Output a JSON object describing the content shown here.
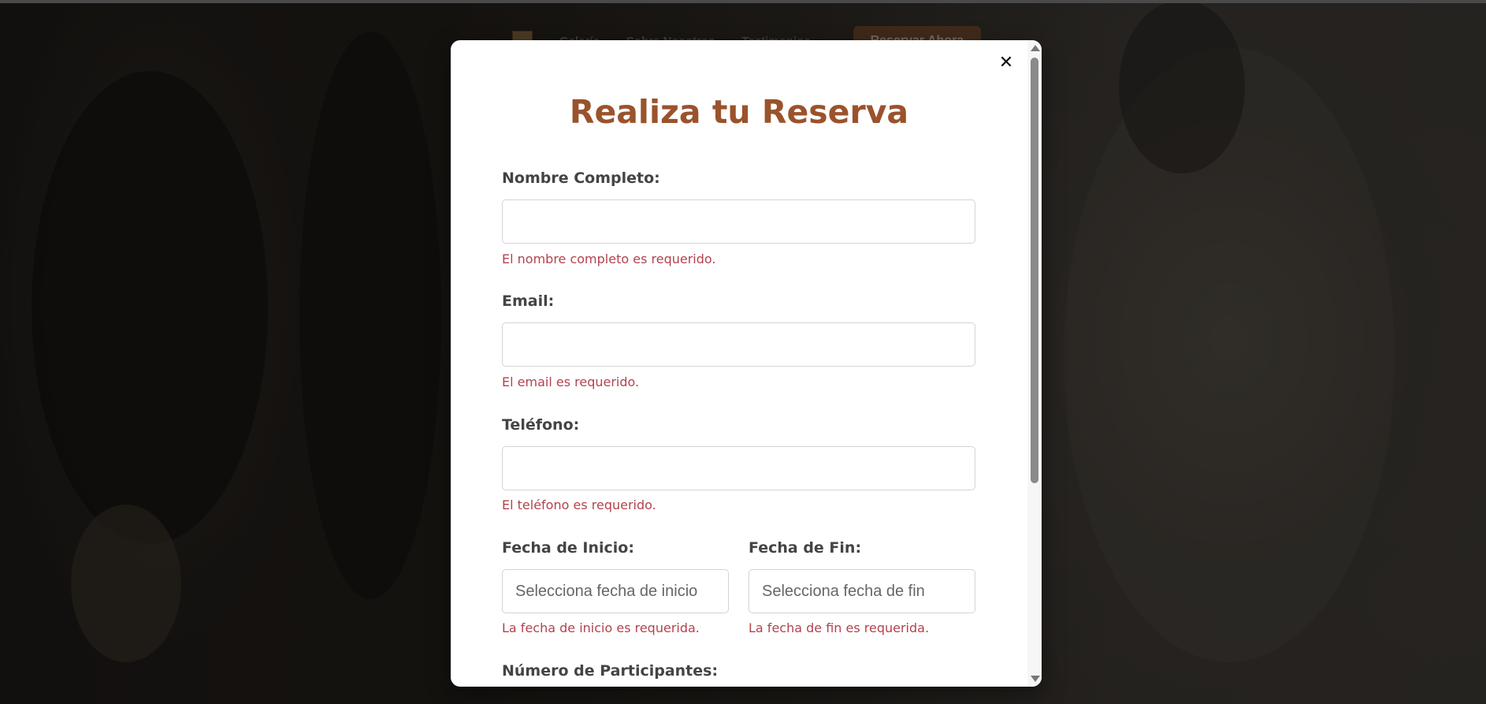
{
  "site_nav": {
    "links": [
      "Galería",
      "Sobre Nosotros",
      "Testimonios"
    ],
    "cta_label": "Reservar Ahora"
  },
  "modal": {
    "title": "Realiza tu Reserva",
    "close_symbol": "✕",
    "fields": {
      "full_name": {
        "label": "Nombre Completo:",
        "value": "",
        "placeholder": "",
        "error": "El nombre completo es requerido."
      },
      "email": {
        "label": "Email:",
        "value": "",
        "placeholder": "",
        "error": "El email es requerido."
      },
      "phone": {
        "label": "Teléfono:",
        "value": "",
        "placeholder": "",
        "error": "El teléfono es requerido."
      },
      "start_date": {
        "label": "Fecha de Inicio:",
        "value": "",
        "placeholder": "Selecciona fecha de inicio",
        "error": "La fecha de inicio es requerida."
      },
      "end_date": {
        "label": "Fecha de Fin:",
        "value": "",
        "placeholder": "Selecciona fecha de fin",
        "error": "La fecha de fin es requerida."
      },
      "participants": {
        "label": "Número de Participantes:"
      }
    }
  },
  "colors": {
    "title": "#9a532c",
    "label": "#444444",
    "error": "#b2424e",
    "cta_background": "#6b3a1c"
  },
  "icons": {
    "close": "close-icon",
    "scroll_up": "scroll-up-arrow-icon",
    "scroll_down": "scroll-down-arrow-icon"
  }
}
